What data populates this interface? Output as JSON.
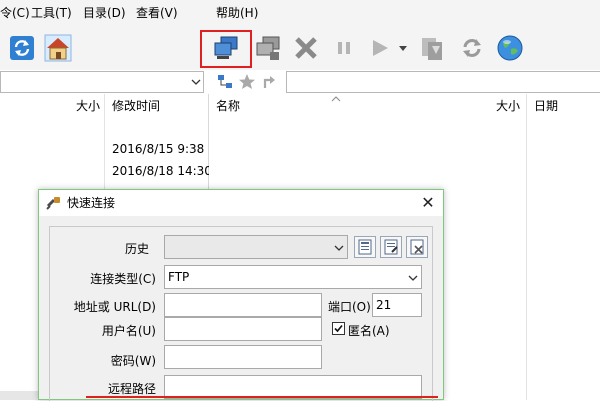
{
  "menu": {
    "items": [
      {
        "label": "令(C)"
      },
      {
        "label": "工具(T)"
      },
      {
        "label": "目录(D)"
      },
      {
        "label": "查看(V)"
      },
      {
        "label": "帮助(H)"
      }
    ]
  },
  "toolbar": {
    "icons": [
      "refresh-icon",
      "home-icon",
      "quick-connect-icon",
      "disconnect-icon",
      "abort-icon",
      "pause-icon",
      "play-icon",
      "download-icon",
      "sync-icon",
      "globe-icon"
    ],
    "highlight_color": "#e02020"
  },
  "left_pane": {
    "columns": [
      "大小",
      "修改时间"
    ],
    "rows": [
      {
        "size": "",
        "modified": "2016/8/15 9:38"
      },
      {
        "size": "",
        "modified": "2016/8/18 14:30"
      }
    ]
  },
  "right_pane": {
    "columns": [
      "名称",
      "大小",
      "日期"
    ]
  },
  "dialog": {
    "title": "快速连接",
    "close": "✕",
    "history_label": "历史",
    "history_value": "",
    "conn_type_label": "连接类型(C)",
    "conn_type_value": "FTP",
    "address_label": "地址或 URL(D)",
    "address_value": "",
    "port_label": "端口(O)",
    "port_value": "21",
    "username_label": "用户名(U)",
    "username_value": "",
    "anonymous_label": "匿名(A)",
    "anonymous_checked": true,
    "password_label": "密码(W)",
    "password_value": "",
    "remote_path_label": "远程路径",
    "remote_path_value": ""
  }
}
